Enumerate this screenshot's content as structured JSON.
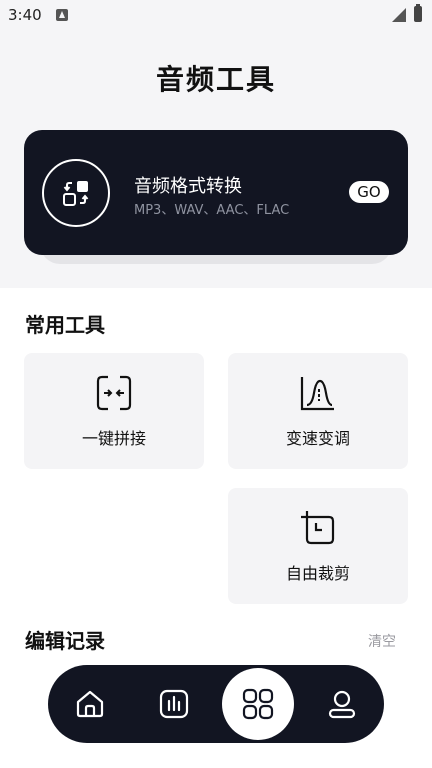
{
  "status_bar": {
    "time": "3:40"
  },
  "header": {
    "title": "音频工具"
  },
  "hero": {
    "title": "音频格式转换",
    "subtitle": "MP3、WAV、AAC、FLAC",
    "go_label": "GO",
    "icon": "format-convert-icon"
  },
  "common_tools": {
    "title": "常用工具",
    "items": [
      {
        "label": "一键拼接",
        "icon": "merge-icon"
      },
      {
        "label": "变速变调",
        "icon": "speed-pitch-icon"
      },
      {
        "label": "自由裁剪",
        "icon": "crop-icon"
      }
    ]
  },
  "edit_history": {
    "title": "编辑记录",
    "clear_label": "清空"
  },
  "tab_bar": {
    "tabs": [
      {
        "icon": "home-icon"
      },
      {
        "icon": "equalizer-icon"
      },
      {
        "icon": "apps-grid-icon",
        "active": true
      },
      {
        "icon": "profile-icon"
      }
    ]
  },
  "colors": {
    "dark": "#121522",
    "background": "#f5f5f7",
    "card": "#f4f4f6"
  }
}
